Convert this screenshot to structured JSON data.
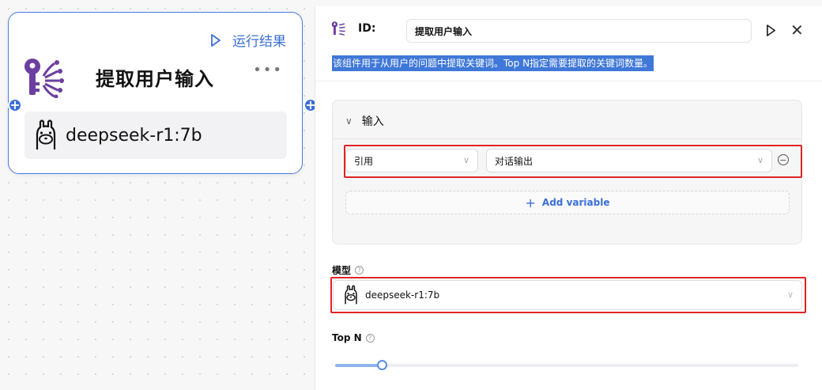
{
  "node": {
    "run_result_label": "运行结果",
    "title": "提取用户输入",
    "more_label": "•••",
    "model": "deepseek-r1:7b",
    "port_symbol": "+"
  },
  "panel": {
    "id_label": "ID:",
    "id_value": "提取用户输入",
    "close_symbol": "✕",
    "description": "该组件用于从用户的问题中提取关键词。Top N指定需要提取的关键词数量。",
    "input_section": {
      "title": "输入",
      "reference_select": "引用",
      "output_select": "对话输出",
      "add_variable_label": "Add variable",
      "add_symbol": "+"
    },
    "model_label": "模型",
    "model_value": "deepseek-r1:7b",
    "topn_label": "Top N",
    "topn_slider_fraction": 0.1,
    "help_symbol": "?"
  },
  "colors": {
    "accent": "#3b6fd6",
    "highlight_border": "#e02424",
    "node_icon": "#6b3fa0"
  }
}
